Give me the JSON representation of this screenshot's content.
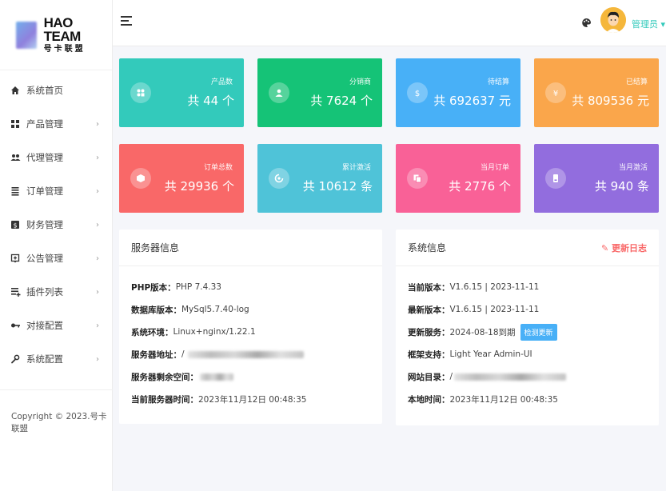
{
  "logo": {
    "title": "HAO TEAM",
    "subtitle": "号卡联盟"
  },
  "sidebar": {
    "items": [
      {
        "label": "系统首页",
        "icon": "home-icon",
        "arrow": ""
      },
      {
        "label": "产品管理",
        "icon": "grid-icon",
        "arrow": "›"
      },
      {
        "label": "代理管理",
        "icon": "users-icon",
        "arrow": "›"
      },
      {
        "label": "订单管理",
        "icon": "list-icon",
        "arrow": "›"
      },
      {
        "label": "财务管理",
        "icon": "dollar-icon",
        "arrow": "›"
      },
      {
        "label": "公告管理",
        "icon": "notice-icon",
        "arrow": "›"
      },
      {
        "label": "插件列表",
        "icon": "plugin-icon",
        "arrow": "›"
      },
      {
        "label": "对接配置",
        "icon": "key-icon",
        "arrow": "›"
      },
      {
        "label": "系统配置",
        "icon": "settings-icon",
        "arrow": "›"
      }
    ],
    "copyright": "Copyright © 2023.号卡联盟"
  },
  "header": {
    "user_label": "管理员 ▾"
  },
  "cards": [
    {
      "label": "产品数",
      "value": "共 44 个",
      "color": "#33cabb",
      "icon": "product-icon"
    },
    {
      "label": "分销商",
      "value": "共 7624 个",
      "color": "#15c377",
      "icon": "user-icon"
    },
    {
      "label": "待结算",
      "value": "共 692637 元",
      "color": "#48b0f7",
      "icon": "dollar-icon"
    },
    {
      "label": "已结算",
      "value": "共 809536 元",
      "color": "#faa64b",
      "icon": "yen-icon"
    },
    {
      "label": "订单总数",
      "value": "共 29936 个",
      "color": "#f96868",
      "icon": "box-icon"
    },
    {
      "label": "累计激活",
      "value": "共 10612 条",
      "color": "#4fc3d8",
      "icon": "activate-icon"
    },
    {
      "label": "当月订单",
      "value": "共 2776 个",
      "color": "#f96197",
      "icon": "copy-icon"
    },
    {
      "label": "当月激活",
      "value": "共 940 条",
      "color": "#926dde",
      "icon": "card-icon"
    }
  ],
  "server": {
    "title": "服务器信息",
    "rows": [
      {
        "k": "PHP版本：",
        "v": "PHP 7.4.33"
      },
      {
        "k": "数据库版本：",
        "v": "MySql5.7.40-log"
      },
      {
        "k": "系统环境：",
        "v": "Linux+nginx/1.22.1"
      },
      {
        "k": "服务器地址：",
        "v": "/"
      },
      {
        "k": "服务器剩余空间：",
        "v": ""
      },
      {
        "k": "当前服务器时间：",
        "v": "2023年11月12日 00:48:35"
      }
    ]
  },
  "system": {
    "title": "系统信息",
    "update_log": "更新日志",
    "check_update": "检测更新",
    "rows": [
      {
        "k": "当前版本：",
        "v": "V1.6.15 | 2023-11-11"
      },
      {
        "k": "最新版本：",
        "v": "V1.6.15 | 2023-11-11"
      },
      {
        "k": "更新服务：",
        "v": "2024-08-18到期"
      },
      {
        "k": "框架支持：",
        "v": "Light Year Admin-UI"
      },
      {
        "k": "网站目录：",
        "v": "/"
      },
      {
        "k": "本地时间：",
        "v": "2023年11月12日 00:48:35"
      }
    ]
  },
  "colors": {
    "accent": "#33cabb",
    "danger": "#f96868",
    "info": "#48b0f7"
  }
}
